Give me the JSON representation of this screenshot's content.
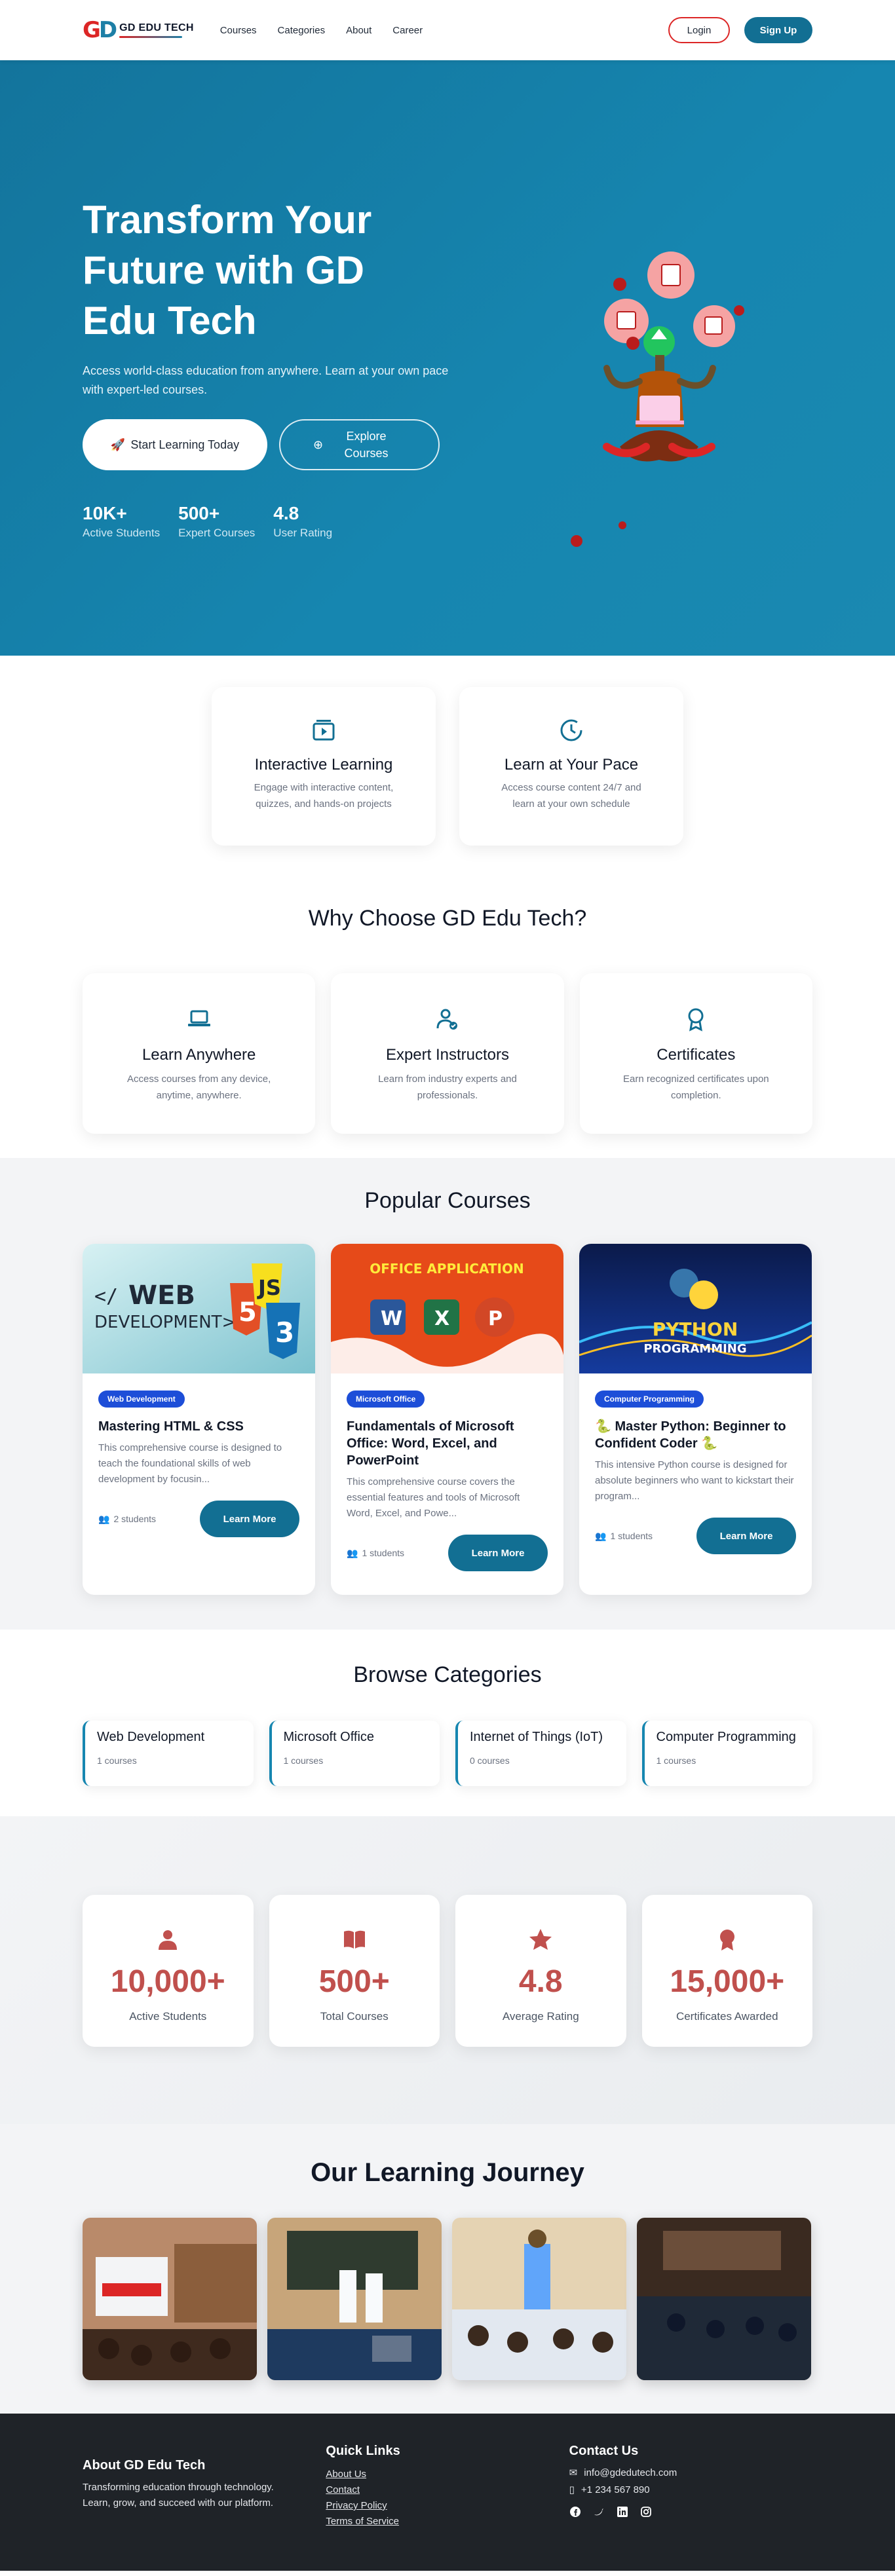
{
  "nav": {
    "brand": "GD EDU TECH",
    "links": [
      "Courses",
      "Categories",
      "About",
      "Career"
    ],
    "login": "Login",
    "signup": "Sign Up"
  },
  "hero": {
    "title": "Transform Your Future with GD Edu Tech",
    "subtitle": "Access world-class education from anywhere. Learn at your own pace with expert-led courses.",
    "start_btn": "Start Learning Today",
    "explore_btn": "Explore Courses",
    "stats": [
      {
        "value": "10K+",
        "label": "Active Students"
      },
      {
        "value": "500+",
        "label": "Expert Courses"
      },
      {
        "value": "4.8",
        "label": "User Rating"
      }
    ]
  },
  "features": [
    {
      "icon": "video-play-icon",
      "title": "Interactive Learning",
      "desc": "Engage with interactive content, quizzes, and hands-on projects"
    },
    {
      "icon": "clock-icon",
      "title": "Learn at Your Pace",
      "desc": "Access course content 24/7 and learn at your own schedule"
    }
  ],
  "why": {
    "title": "Why Choose GD Edu Tech?",
    "items": [
      {
        "icon": "laptop-icon",
        "title": "Learn Anywhere",
        "desc": "Access courses from any device, anytime, anywhere."
      },
      {
        "icon": "instructor-icon",
        "title": "Expert Instructors",
        "desc": "Learn from industry experts and professionals."
      },
      {
        "icon": "award-icon",
        "title": "Certificates",
        "desc": "Earn recognized certificates upon completion."
      }
    ]
  },
  "courses": {
    "title": "Popular Courses",
    "items": [
      {
        "badge": "Web Development",
        "title": "Mastering HTML & CSS",
        "desc": "This comprehensive course is designed to teach the foundational skills of web development by focusin...",
        "students": "2 students",
        "btn": "Learn More",
        "img_text": "WEB DEVELOPMENT"
      },
      {
        "badge": "Microsoft Office",
        "title": "Fundamentals of Microsoft Office: Word, Excel, and PowerPoint",
        "desc": "This comprehensive course covers the essential features and tools of Microsoft Word, Excel, and Powe...",
        "students": "1 students",
        "btn": "Learn More",
        "img_text": "OFFICE APPLICATION"
      },
      {
        "badge": "Computer Programming",
        "title": "🐍 Master Python: Beginner to Confident Coder 🐍",
        "desc": "This intensive Python course is designed for absolute beginners who want to kickstart their program...",
        "students": "1 students",
        "btn": "Learn More",
        "img_text": "PYTHON PROGRAMMING"
      }
    ]
  },
  "categories": {
    "title": "Browse Categories",
    "items": [
      {
        "name": "Web Development",
        "count": "1 courses"
      },
      {
        "name": "Microsoft Office",
        "count": "1 courses"
      },
      {
        "name": "Internet of Things (IoT)",
        "count": "0 courses"
      },
      {
        "name": "Computer Programming",
        "count": "1 courses"
      }
    ]
  },
  "stats": [
    {
      "icon": "user-icon",
      "value": "10,000+",
      "label": "Active Students"
    },
    {
      "icon": "book-icon",
      "value": "500+",
      "label": "Total Courses"
    },
    {
      "icon": "star-icon",
      "value": "4.8",
      "label": "Average Rating"
    },
    {
      "icon": "certificate-icon",
      "value": "15,000+",
      "label": "Certificates Awarded"
    }
  ],
  "journey": {
    "title": "Our Learning Journey"
  },
  "footer": {
    "about_title": "About GD Edu Tech",
    "about_text": "Transforming education through technology. Learn, grow, and succeed with our platform.",
    "links_title": "Quick Links",
    "links": [
      "About Us",
      "Contact",
      "Privacy Policy",
      "Terms of Service"
    ],
    "contact_title": "Contact Us",
    "email": "info@gdedutech.com",
    "phone": "+1 234 567 890"
  },
  "colors": {
    "primary": "#126f93",
    "accent": "#dc2626",
    "stat": "#c0504d"
  }
}
